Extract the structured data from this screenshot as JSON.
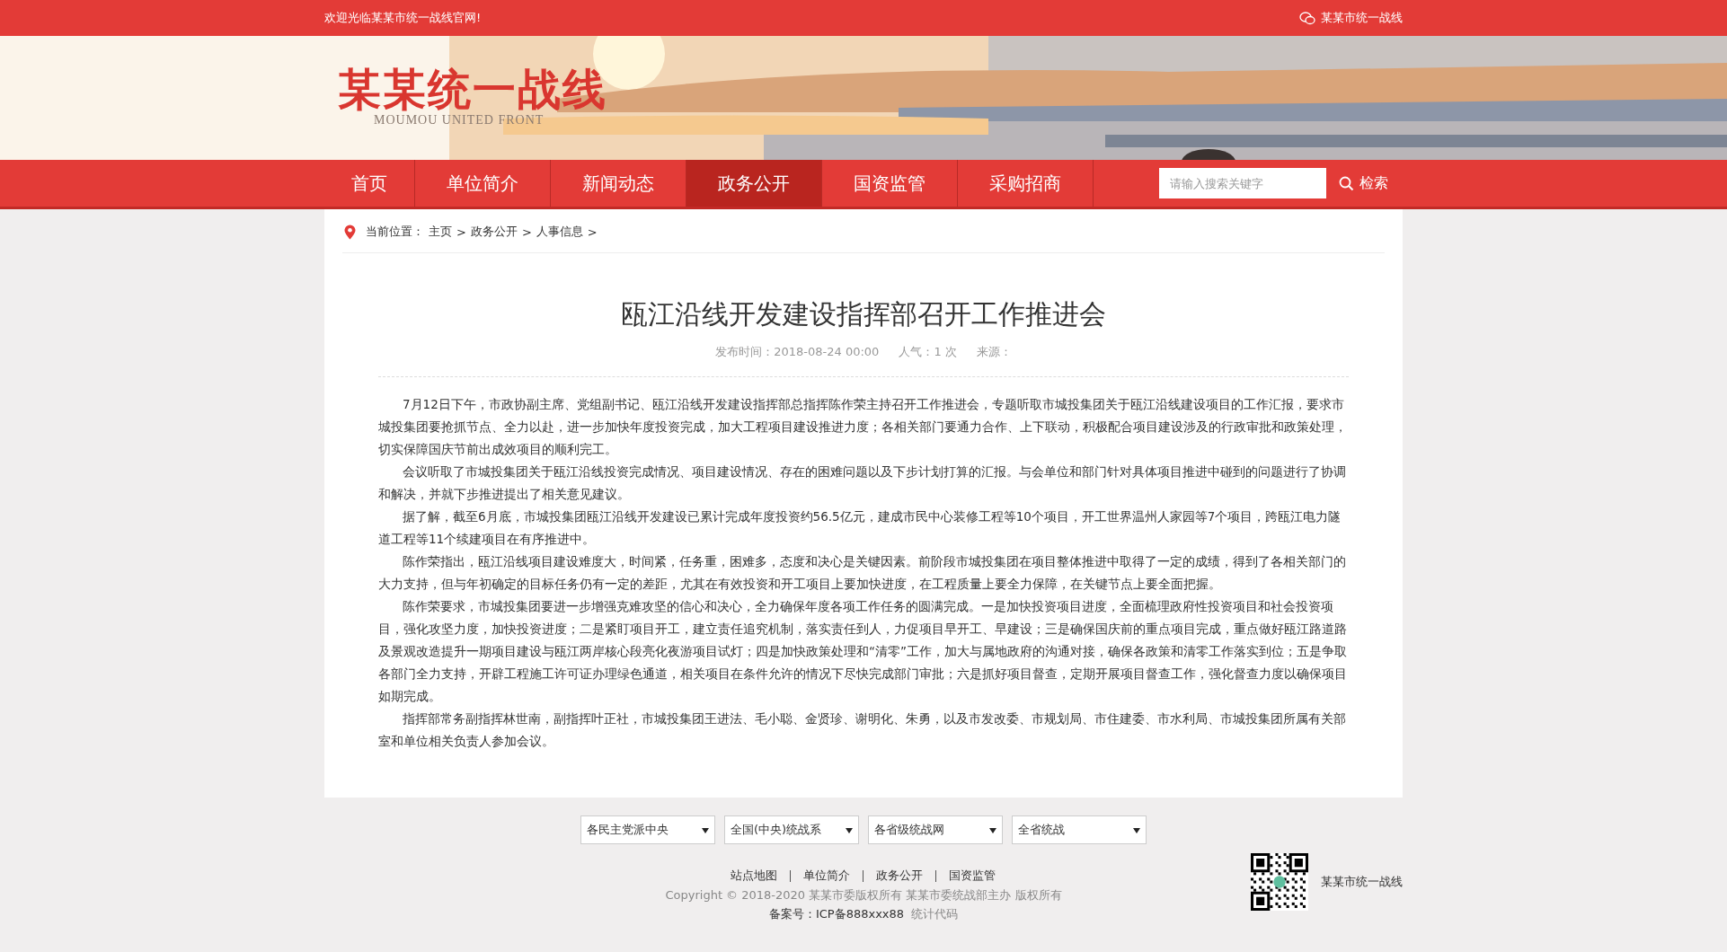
{
  "top_bar": {
    "welcome": "欢迎光临某某市统一战线官网!",
    "wechat_label": "某某市统一战线"
  },
  "header": {
    "logo_title": "某某统一战线",
    "logo_subtitle": "MOUMOU UNITED FRONT"
  },
  "nav": {
    "items": [
      {
        "label": "首页",
        "selected": false
      },
      {
        "label": "单位简介",
        "selected": false
      },
      {
        "label": "新闻动态",
        "selected": false
      },
      {
        "label": "政务公开",
        "selected": true
      },
      {
        "label": "国资监管",
        "selected": false
      },
      {
        "label": "采购招商",
        "selected": false
      }
    ],
    "search": {
      "placeholder": "请输入搜索关键字",
      "button": "检索"
    }
  },
  "breadcrumb": {
    "label": "当前位置：",
    "items": [
      "主页",
      "政务公开",
      "人事信息"
    ],
    "separator": ">"
  },
  "article": {
    "title": "瓯江沿线开发建设指挥部召开工作推进会",
    "meta": [
      "发布时间：2018-08-24 00:00",
      "人气：1 次",
      "来源："
    ],
    "paragraphs": [
      "7月12日下午，市政协副主席、党组副书记、瓯江沿线开发建设指挥部总指挥陈作荣主持召开工作推进会，专题听取市城投集团关于瓯江沿线建设项目的工作汇报，要求市城投集团要抢抓节点、全力以赴，进一步加快年度投资完成，加大工程项目建设推进力度；各相关部门要通力合作、上下联动，积极配合项目建设涉及的行政审批和政策处理，切实保障国庆节前出成效项目的顺利完工。",
      "会议听取了市城投集团关于瓯江沿线投资完成情况、项目建设情况、存在的困难问题以及下步计划打算的汇报。与会单位和部门针对具体项目推进中碰到的问题进行了协调和解决，并就下步推进提出了相关意见建议。",
      "据了解，截至6月底，市城投集团瓯江沿线开发建设已累计完成年度投资约56.5亿元，建成市民中心装修工程等10个项目，开工世界温州人家园等7个项目，跨瓯江电力隧道工程等11个续建项目在有序推进中。",
      "陈作荣指出，瓯江沿线项目建设难度大，时间紧，任务重，困难多，态度和决心是关键因素。前阶段市城投集团在项目整体推进中取得了一定的成绩，得到了各相关部门的大力支持，但与年初确定的目标任务仍有一定的差距，尤其在有效投资和开工项目上要加快进度，在工程质量上要全力保障，在关键节点上要全面把握。",
      "陈作荣要求，市城投集团要进一步增强克难攻坚的信心和决心，全力确保年度各项工作任务的圆满完成。一是加快投资项目进度，全面梳理政府性投资项目和社会投资项目，强化攻坚力度，加快投资进度；二是紧盯项目开工，建立责任追究机制，落实责任到人，力促项目早开工、早建设；三是确保国庆前的重点项目完成，重点做好瓯江路道路及景观改造提升一期项目建设与瓯江两岸核心段亮化夜游项目试灯；四是加快政策处理和“清零”工作，加大与属地政府的沟通对接，确保各政策和清零工作落实到位；五是争取各部门全力支持，开辟工程施工许可证办理绿色通道，相关项目在条件允许的情况下尽快完成部门审批；六是抓好项目督查，定期开展项目督查工作，强化督查力度以确保项目如期完成。",
      "指挥部常务副指挥林世南，副指挥叶正社，市城投集团王进法、毛小聪、金贤珍、谢明化、朱勇，以及市发改委、市规划局、市住建委、市水利局、市城投集团所属有关部室和单位相关负责人参加会议。"
    ]
  },
  "footer": {
    "selects": [
      "各民主党派中央",
      "全国(中央)统战系",
      "各省级统战网",
      "全省统战"
    ],
    "links": [
      "站点地图",
      "单位简介",
      "政务公开",
      "国资监管"
    ],
    "copyright": "Copyright © 2018-2020 某某市委版权所有 某某市委统战部主办 版权所有",
    "icp_label": "备案号：ICP备888xxx88",
    "stats_link": "统计代码",
    "qr_label": "某某市统一战线"
  }
}
